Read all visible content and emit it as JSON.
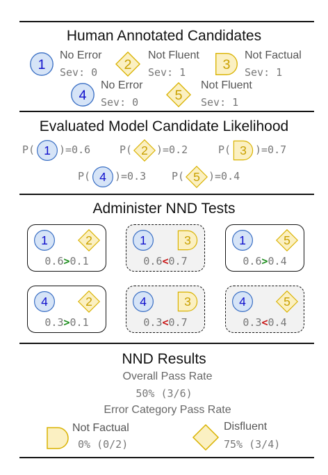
{
  "sections": {
    "annotated_title": "Human Annotated Candidates",
    "likelihood_title": "Evaluated Model Candidate Likelihood",
    "tests_title": "Administer NND Tests",
    "results_title": "NND Results"
  },
  "candidates": [
    {
      "num": "1",
      "shape": "circle",
      "label": "No Error",
      "sev": "Sev: 0"
    },
    {
      "num": "2",
      "shape": "diamond",
      "label": "Not Fluent",
      "sev": "Sev: 1"
    },
    {
      "num": "3",
      "shape": "half-round",
      "label": "Not Factual",
      "sev": "Sev: 1"
    },
    {
      "num": "4",
      "shape": "circle",
      "label": "No Error",
      "sev": "Sev: 0"
    },
    {
      "num": "5",
      "shape": "diamond",
      "label": "Not Fluent",
      "sev": "Sev: 1"
    }
  ],
  "likelihoods": [
    {
      "prefix": "P(",
      "num": "1",
      "suffix": ")=0.6"
    },
    {
      "prefix": "P(",
      "num": "2",
      "suffix": ")=0.2"
    },
    {
      "prefix": "P(",
      "num": "3",
      "suffix": ")=0.7"
    },
    {
      "prefix": "P(",
      "num": "4",
      "suffix": ")=0.3"
    },
    {
      "prefix": "P(",
      "num": "5",
      "suffix": ")=0.4"
    }
  ],
  "tests": [
    {
      "a": "1",
      "b": "2",
      "left": "0.6",
      "op": ">",
      "right": "0.1",
      "pass": true
    },
    {
      "a": "1",
      "b": "3",
      "left": "0.6",
      "op": "<",
      "right": "0.7",
      "pass": false
    },
    {
      "a": "1",
      "b": "5",
      "left": "0.6",
      "op": ">",
      "right": "0.4",
      "pass": true
    },
    {
      "a": "4",
      "b": "2",
      "left": "0.3",
      "op": ">",
      "right": "0.1",
      "pass": true
    },
    {
      "a": "4",
      "b": "3",
      "left": "0.3",
      "op": "<",
      "right": "0.7",
      "pass": false
    },
    {
      "a": "4",
      "b": "5",
      "left": "0.3",
      "op": "<",
      "right": "0.4",
      "pass": false
    }
  ],
  "results": {
    "overall_label": "Overall Pass Rate",
    "overall_value": "50% (3/6)",
    "category_label": "Error Category Pass Rate",
    "factual_label": "Not Factual",
    "factual_value": "0% (0/2)",
    "fluent_label": "Disfluent",
    "fluent_value": "75% (3/4)"
  },
  "colors": {
    "circle_fill": "#d6e4f7",
    "circle_stroke": "#3a6fc4",
    "circle_text": "#1010cc",
    "gold_fill": "#fbf0c2",
    "gold_stroke": "#d9b200",
    "gold_text": "#c9a000",
    "pass": "#1a8c1a",
    "fail": "#c81414"
  }
}
